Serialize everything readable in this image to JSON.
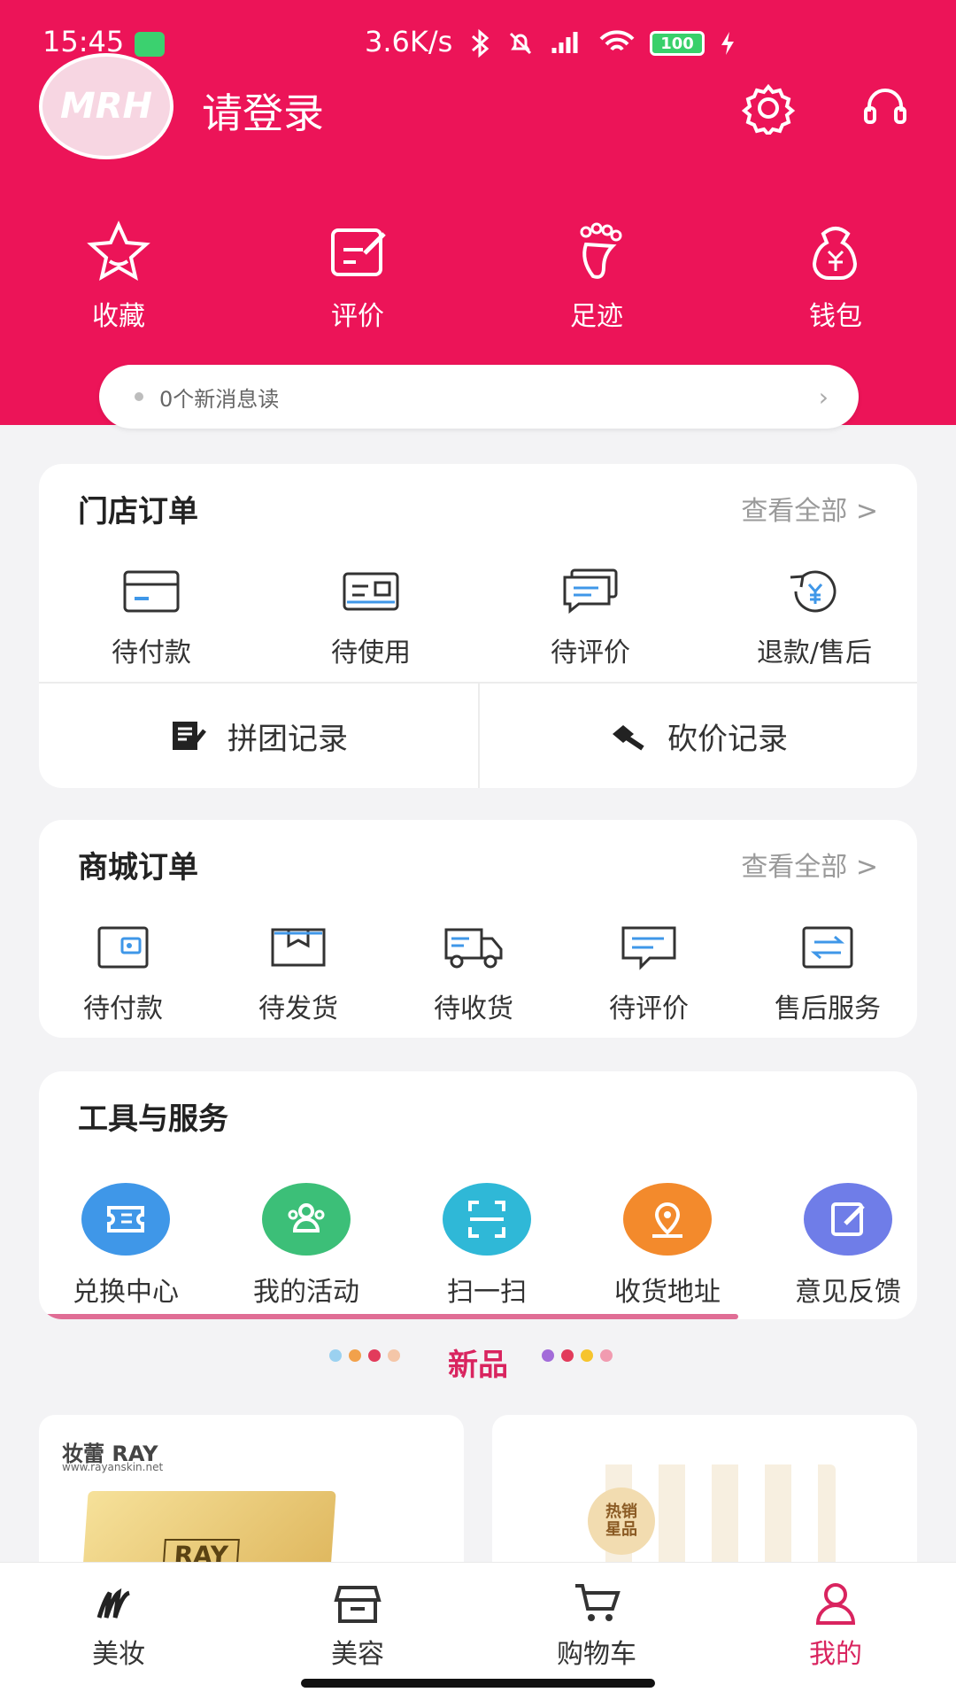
{
  "status_bar": {
    "time": "15:45",
    "network_rate": "3.6K/s",
    "battery": "100"
  },
  "header": {
    "avatar_text": "MRH",
    "login_text": "请登录",
    "accent_color": "#ec1458",
    "quick_actions": [
      {
        "label": "收藏",
        "icon": "star-icon"
      },
      {
        "label": "评价",
        "icon": "edit-icon"
      },
      {
        "label": "足迹",
        "icon": "footprint-icon"
      },
      {
        "label": "钱包",
        "icon": "wallet-icon"
      }
    ]
  },
  "notice": {
    "text": "0个新消息读"
  },
  "store_orders": {
    "title": "门店订单",
    "view_all": "查看全部 >",
    "items": [
      {
        "label": "待付款",
        "icon": "card-icon"
      },
      {
        "label": "待使用",
        "icon": "ticket-icon"
      },
      {
        "label": "待评价",
        "icon": "chat-icon"
      },
      {
        "label": "退款/售后",
        "icon": "refund-icon"
      }
    ],
    "group_buy": "拼团记录",
    "bargain": "砍价记录"
  },
  "mall_orders": {
    "title": "商城订单",
    "view_all": "查看全部 >",
    "items": [
      {
        "label": "待付款",
        "icon": "wallet-box-icon"
      },
      {
        "label": "待发货",
        "icon": "package-icon"
      },
      {
        "label": "待收货",
        "icon": "truck-icon"
      },
      {
        "label": "待评价",
        "icon": "chat-icon"
      },
      {
        "label": "售后服务",
        "icon": "exchange-icon"
      }
    ]
  },
  "tools": {
    "title": "工具与服务",
    "items": [
      {
        "label": "兑换中心",
        "icon": "ticket-icon",
        "color": "#3f97e8"
      },
      {
        "label": "我的活动",
        "icon": "users-icon",
        "color": "#3cbf78"
      },
      {
        "label": "扫一扫",
        "icon": "scan-icon",
        "color": "#2fb8d7"
      },
      {
        "label": "收货地址",
        "icon": "location-icon",
        "color": "#f38a2c"
      },
      {
        "label": "意见反馈",
        "icon": "edit-icon",
        "color": "#6f7de8"
      }
    ]
  },
  "new_products": {
    "title": "新品",
    "products": [
      {
        "brand": "妆蕾 RAY",
        "url": "www.rayanskin.net",
        "box_text": "RAY"
      },
      {
        "badge": "热销\n星品"
      }
    ]
  },
  "tabbar": {
    "tabs": [
      {
        "label": "美妆",
        "icon": "makeup-icon"
      },
      {
        "label": "美容",
        "icon": "store-icon"
      },
      {
        "label": "购物车",
        "icon": "cart-icon"
      },
      {
        "label": "我的",
        "icon": "user-icon",
        "active": true
      }
    ],
    "active_color": "#d9245f"
  }
}
